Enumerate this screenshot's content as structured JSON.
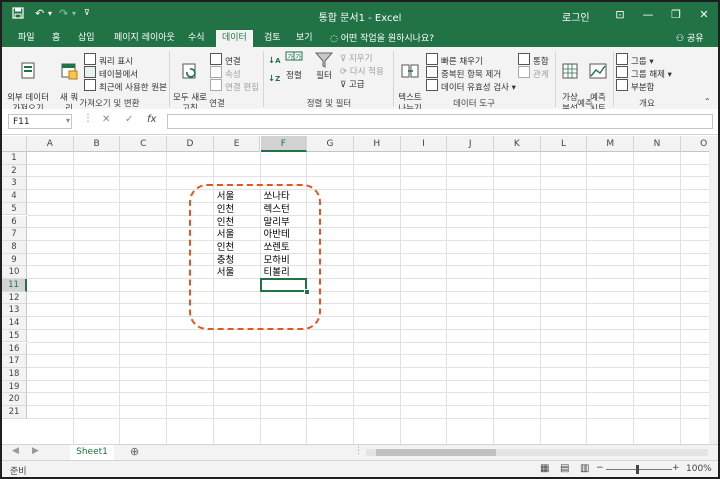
{
  "titlebar": {
    "title": "통합 문서1 - Excel",
    "login": "로그인",
    "save_icon": "save-icon",
    "undo_icon": "undo-icon",
    "redo_icon": "redo-icon",
    "minimize": "—",
    "restore": "❐",
    "close": "✕",
    "ribbon_opts": "⊡"
  },
  "tabs": [
    "파일",
    "홈",
    "삽입",
    "페이지 레이아웃",
    "수식",
    "데이터",
    "검토",
    "보기"
  ],
  "active_tab": "데이터",
  "tellme": "어떤 작업을 원하시나요?",
  "share": "공유",
  "ribbon": {
    "get_external": "외부 데이터\n가져오기",
    "new_query": "새 쿼\n리",
    "show_queries": "쿼리 표시",
    "from_table": "테이블에서",
    "recent_sources": "최근에 사용한 원본",
    "group_get": "가져오기 및 변환",
    "refresh_all": "모두 새로\n고침",
    "connections": "연결",
    "properties": "속성",
    "edit_links": "연결 편집",
    "group_conn": "연결",
    "sort": "정렬",
    "filter": "필터",
    "clear": "지우기",
    "reapply": "다시 적용",
    "advanced": "고급",
    "group_sort": "정렬 및 필터",
    "text_to_columns": "텍스트\n나누기",
    "flash_fill": "빠른 채우기",
    "remove_dup": "중복된 항목 제거",
    "validation": "데이터 유효성 검사",
    "consolidate": "통합",
    "relationships": "관계",
    "group_tools": "데이터 도구",
    "what_if": "가상\n분석",
    "forecast": "예측\n시트",
    "group_forecast": "예측",
    "group_btn": "그룹",
    "ungroup": "그룹 해제",
    "subtotal": "부분합",
    "group_outline": "개요"
  },
  "formula_bar": {
    "name_box": "F11",
    "cancel": "✕",
    "enter": "✓",
    "fx": "fx",
    "value": ""
  },
  "columns": [
    "A",
    "B",
    "C",
    "D",
    "E",
    "F",
    "G",
    "H",
    "I",
    "J",
    "K",
    "L",
    "M",
    "N",
    "O"
  ],
  "rows": [
    "1",
    "2",
    "3",
    "4",
    "5",
    "6",
    "7",
    "8",
    "9",
    "10",
    "11",
    "12",
    "13",
    "14",
    "15",
    "16",
    "17",
    "18",
    "19",
    "20",
    "21"
  ],
  "selected_cell": "F11",
  "cells": {
    "E": [
      "서울",
      "인천",
      "인천",
      "서울",
      "인천",
      "충청",
      "서울"
    ],
    "F": [
      "쏘나타",
      "렉스턴",
      "말리부",
      "아반테",
      "쏘렌토",
      "모하비",
      "티볼리"
    ]
  },
  "sheets": [
    "Sheet1"
  ],
  "add_sheet": "⊕",
  "status": {
    "ready": "준비",
    "zoom": "100%",
    "minus": "−",
    "plus": "+"
  },
  "colors": {
    "brand": "#217346",
    "annotation": "#e8541f"
  }
}
